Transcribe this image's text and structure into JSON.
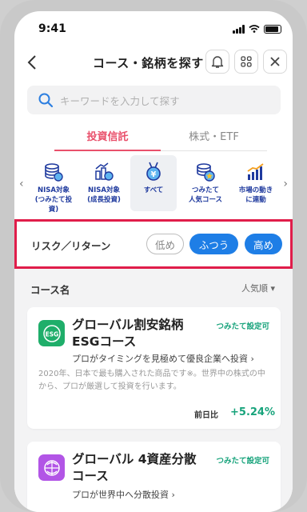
{
  "status": {
    "time": "9:41"
  },
  "header": {
    "title": "コース・銘柄を探す"
  },
  "search": {
    "placeholder": "キーワードを入力して探す"
  },
  "tabs": [
    {
      "label": "投資信託",
      "active": true
    },
    {
      "label": "株式・ETF",
      "active": false
    }
  ],
  "categories": [
    {
      "label": "NISA対象\n(つみたて投資)",
      "icon": "nisa-coin-stack-icon"
    },
    {
      "label": "NISA対象\n(成長投資)",
      "icon": "growth-coins-icon"
    },
    {
      "label": "すべて",
      "icon": "yen-medal-icon",
      "selected": true
    },
    {
      "label": "つみたて\n人気コース",
      "icon": "popular-coins-star-icon"
    },
    {
      "label": "市場の動き\nに連動",
      "icon": "market-bar-chart-icon"
    }
  ],
  "risk": {
    "label": "リスク／リターン",
    "options": [
      {
        "label": "低め",
        "active": false
      },
      {
        "label": "ふつう",
        "active": true
      },
      {
        "label": "高め",
        "active": true
      }
    ]
  },
  "list": {
    "title": "コース名",
    "sort_label": "人気順",
    "funds": [
      {
        "name": "グローバル割安銘柄\nESGコース",
        "badge": "つみたて設定可",
        "tag": "プロがタイミングを見極めて優良企業へ投資",
        "description": "2020年、日本で最も購入された商品です※。世界中の株式の中から、プロが厳選して投資を行います。",
        "change_label": "前日比",
        "change": "+5.24%",
        "icon": "esg-globe-icon"
      },
      {
        "name": "グローバル 4資産分散\nコース",
        "badge": "つみたて設定可",
        "tag": "プロが世界中へ分散投資",
        "icon": "globe-arrows-icon"
      }
    ]
  },
  "colors": {
    "accent_red": "#e9506b",
    "highlight_border": "#e01d4a",
    "active_blue": "#1e7ee6",
    "gain_green": "#17a37b"
  }
}
